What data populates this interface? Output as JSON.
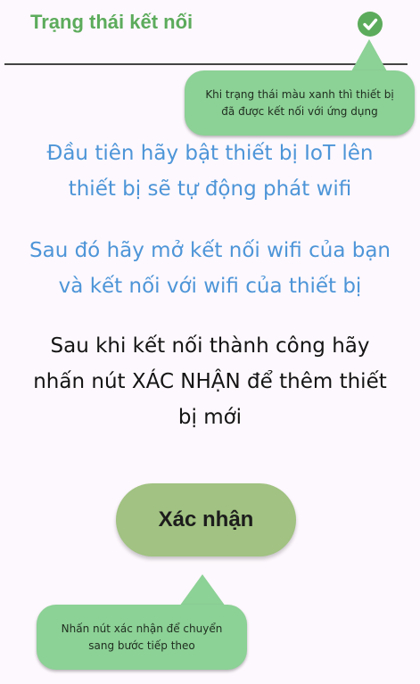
{
  "header": {
    "status_title": "Trạng thái kết nối",
    "status_icon": "check-circle-icon",
    "status_color": "#5cab5c"
  },
  "tooltips": {
    "connection_hint": "Khi trạng thái màu xanh thì thiết bị đã được kết nối với ứng dụng",
    "button_hint": "Nhấn nút xác nhận để chuyển sang bước tiếp theo",
    "bubble_color": "#8cd196"
  },
  "instructions": {
    "step1": [
      "Đầu tiên hãy bật thiết bị IoT lên",
      "thiết bị sẽ tự động phát wifi"
    ],
    "step2": [
      "Sau đó hãy mở kết nối wifi của bạn",
      "và kết nối với wifi của thiết bị"
    ],
    "step3": [
      "Sau khi kết nối thành công hãy",
      "nhấn nút XÁC NHẬN để thêm thiết",
      "bị mới"
    ],
    "accent_color": "#4d95d8"
  },
  "confirm_button": {
    "label": "Xác nhận",
    "color": "#a1c282"
  }
}
